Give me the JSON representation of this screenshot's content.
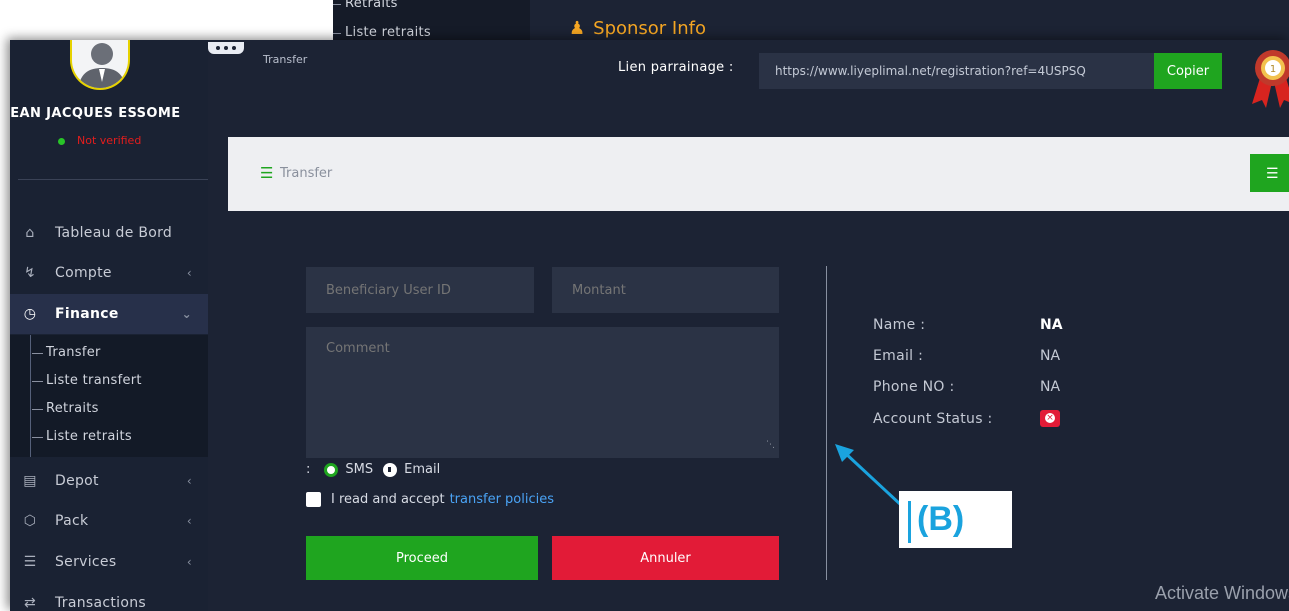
{
  "background_window": {
    "submenu_items": [
      "Retraits",
      "Liste retraits"
    ],
    "section_title": "Sponsor Info"
  },
  "user": {
    "name": "JEAN JACQUES ESSOME",
    "status": "Not verified"
  },
  "sidebar": {
    "items": [
      {
        "label": "Tableau de Bord",
        "icon": "home-icon"
      },
      {
        "label": "Compte",
        "icon": "key-icon"
      },
      {
        "label": "Finance",
        "icon": "clock-icon"
      },
      {
        "label": "Depot",
        "icon": "card-icon"
      },
      {
        "label": "Pack",
        "icon": "box-icon"
      },
      {
        "label": "Services",
        "icon": "list-icon"
      },
      {
        "label": "Transactions",
        "icon": "transfer-arrows-icon"
      }
    ],
    "finance_submenu": [
      "Transfer",
      "Liste transfert",
      "Retraits",
      "Liste retraits"
    ]
  },
  "topbar": {
    "breadcrumb": "Transfer",
    "referral_label": "Lien parrainage :",
    "referral_link": "https://www.liyeplimal.net/registration?ref=4USPSQ",
    "copy_label": "Copier"
  },
  "page_header": {
    "title": "Transfer"
  },
  "form": {
    "beneficiary_placeholder": "Beneficiary User ID",
    "amount_placeholder": "Montant",
    "comment_placeholder": "Comment",
    "radio_prefix": ":",
    "option_sms": "SMS",
    "option_email": "Email",
    "accept_text": "I read and accept",
    "policy_link": "transfer policies",
    "proceed_label": "Proceed",
    "cancel_label": "Annuler"
  },
  "beneficiary_info": {
    "name_label": "Name :",
    "name_value": "NA",
    "email_label": "Email :",
    "email_value": "NA",
    "phone_label": "Phone NO :",
    "phone_value": "NA",
    "status_label": "Account Status :"
  },
  "annotation": {
    "label": "(B)"
  },
  "watermark": "Activate Windows",
  "colors": {
    "accent_green": "#1fa51f",
    "danger_red": "#e21b37",
    "panel_dark": "#1c2334",
    "sponsor_orange": "#f5a623",
    "annotation_blue": "#1aa3de"
  }
}
